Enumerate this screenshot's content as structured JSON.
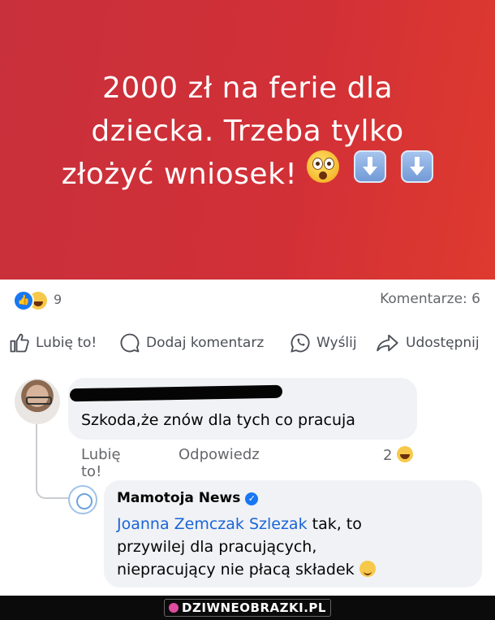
{
  "banner": {
    "line1": "2000 zł na ferie dla",
    "line2": "dziecka. Trzeba tylko",
    "line3": "złożyć wniosek!"
  },
  "stats": {
    "reaction_count": "9",
    "comments_label": "Komentarze: 6"
  },
  "actions": {
    "like": "Lubię to!",
    "comment": "Dodaj komentarz",
    "send": "Wyślij",
    "share": "Udostępnij"
  },
  "comment1": {
    "text": "Szkoda,że znów dla tych co pracuja",
    "like": "Lubię to!",
    "reply": "Odpowiedz",
    "reaction_count": "2"
  },
  "reply1": {
    "author": "Mamotoja News",
    "mention": "Joanna Zemczak Szlezak",
    "text_line1": " tak, to",
    "text_line2": "przywilej dla pracujących,",
    "text_line3": "niepracujący nie płacą składek"
  },
  "footer": {
    "site": "DZIWNEOBRAZKI.PL"
  },
  "colors": {
    "banner": "#d23037",
    "accent": "#1877f2",
    "mention": "#1a64d8"
  }
}
